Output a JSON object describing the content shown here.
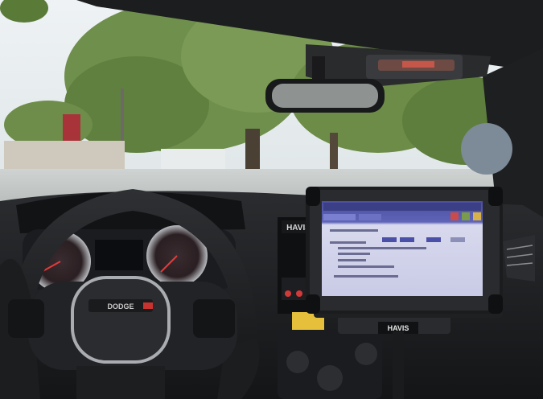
{
  "dashboard": {
    "steering_wheel_badge": "DODGE",
    "dash_brand_label": "HAVIS",
    "mount_brand_label": "HAVIS"
  },
  "tablet": {
    "app_header": "",
    "menu_items": [],
    "form_lines": []
  }
}
